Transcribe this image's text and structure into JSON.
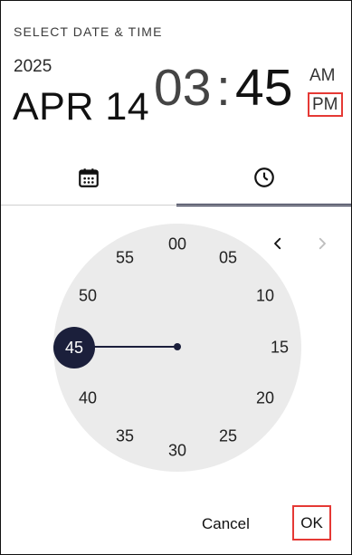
{
  "header": {
    "title": "SELECT DATE & TIME",
    "year": "2025",
    "date": "APR 14",
    "hour": "03",
    "separator": ":",
    "minute": "45",
    "am": "AM",
    "pm": "PM"
  },
  "tabs": [
    {
      "name": "calendar",
      "icon": "calendar-icon",
      "selected": false
    },
    {
      "name": "clock",
      "icon": "clock-icon",
      "selected": true
    }
  ],
  "clock": {
    "labels": [
      "00",
      "05",
      "10",
      "15",
      "20",
      "25",
      "30",
      "35",
      "40",
      "45",
      "50",
      "55"
    ],
    "selected": "45",
    "prev_icon": "chevron-left-icon",
    "next_icon": "chevron-right-icon"
  },
  "actions": {
    "cancel": "Cancel",
    "ok": "OK"
  },
  "colors": {
    "accent": "#1b1f3b",
    "dial": "#ebebeb",
    "highlight": "#e53935"
  }
}
